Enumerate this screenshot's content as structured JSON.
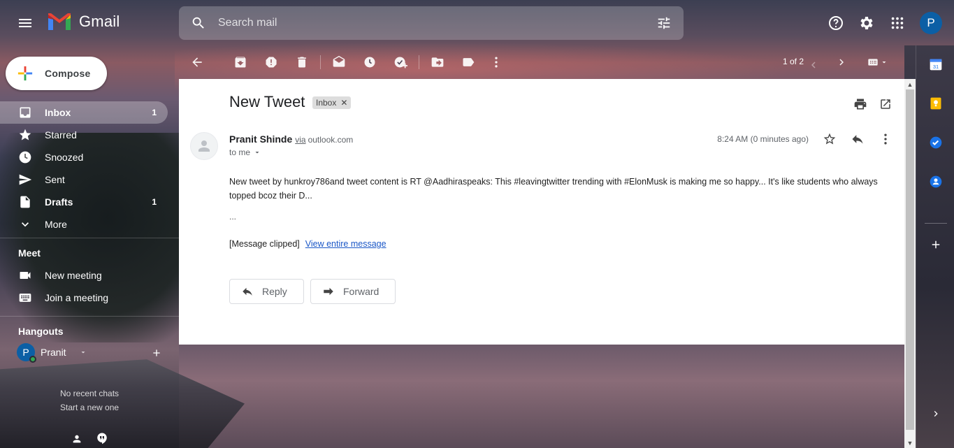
{
  "header": {
    "app_name": "Gmail",
    "search_placeholder": "Search mail",
    "avatar_letter": "P"
  },
  "compose": {
    "label": "Compose"
  },
  "nav": {
    "items": [
      {
        "label": "Inbox",
        "count": "1",
        "icon": "inbox-icon",
        "active": true
      },
      {
        "label": "Starred",
        "count": "",
        "icon": "star-icon"
      },
      {
        "label": "Snoozed",
        "count": "",
        "icon": "clock-icon"
      },
      {
        "label": "Sent",
        "count": "",
        "icon": "send-icon"
      },
      {
        "label": "Drafts",
        "count": "1",
        "icon": "draft-icon"
      },
      {
        "label": "More",
        "count": "",
        "icon": "chevron-down-icon"
      }
    ]
  },
  "meet": {
    "title": "Meet",
    "new_meeting": "New meeting",
    "join_meeting": "Join a meeting"
  },
  "hangouts": {
    "title": "Hangouts",
    "user_name": "Pranit",
    "avatar_letter": "P",
    "no_recent": "No recent chats",
    "start_new": "Start a new one"
  },
  "toolbar": {
    "pager": "1 of 2"
  },
  "message": {
    "subject": "New Tweet",
    "label": "Inbox",
    "sender_name": "Pranit Shinde",
    "via": "via",
    "domain": "outlook.com",
    "to": "to me",
    "timestamp": "8:24 AM (0 minutes ago)",
    "body": "New tweet by  hunkroy786and tweet content is RT @Aadhiraspeaks: This #leavingtwitter trending with #ElonMusk is making me so happy... It's like students who always topped bcoz their D...",
    "ellipsis": "...",
    "clipped": "[Message clipped]",
    "view_entire": "View entire message",
    "reply_label": "Reply",
    "forward_label": "Forward"
  },
  "colors": {
    "accent_blue": "#1a73e8",
    "avatar_blue": "#0b5fa5",
    "online_green": "#34a853"
  }
}
